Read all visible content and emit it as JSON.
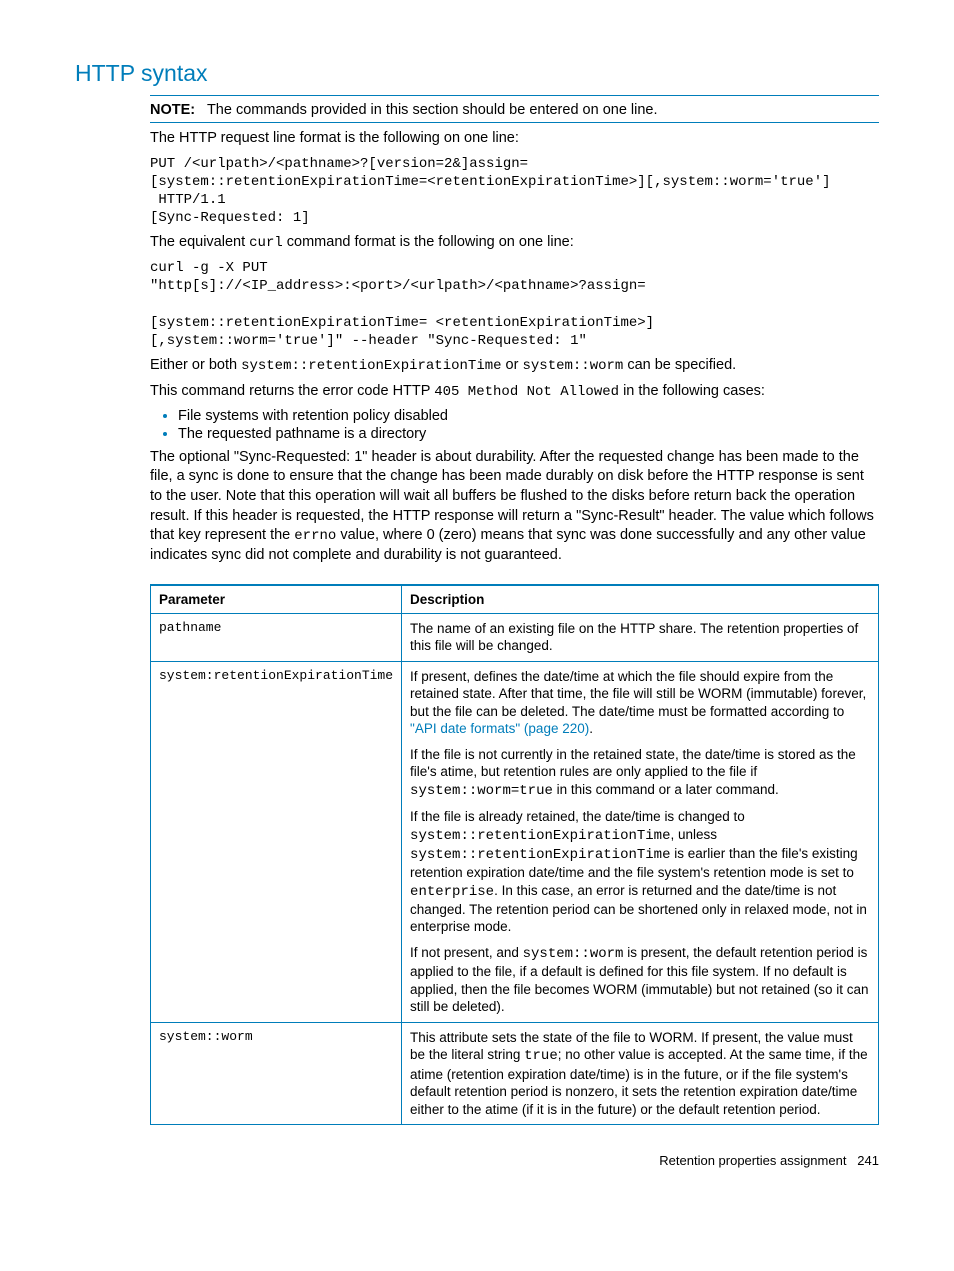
{
  "heading": "HTTP syntax",
  "note": {
    "label": "NOTE:",
    "text": "The commands provided in this section should be entered on one line."
  },
  "intro1": "The HTTP request line format is the following on one line:",
  "code1": "PUT /<urlpath>/<pathname>?[version=2&]assign=\n[system::retentionExpirationTime=<retentionExpirationTime>][,system::worm='true']\n HTTP/1.1\n[Sync-Requested: 1]",
  "intro2_pre": "The equivalent ",
  "intro2_code": "curl",
  "intro2_post": " command format is the following on one line:",
  "code2": "curl -g -X PUT \n\"http[s]://<IP_address>:<port>/<urlpath>/<pathname>?assign=\n\n[system::retentionExpirationTime= <retentionExpirationTime>]\n[,system::worm='true']\" --header \"Sync-Requested: 1\"",
  "either_pre": "Either or both ",
  "either_c1": "system::retentionExpirationTime",
  "either_mid": " or ",
  "either_c2": "system::worm",
  "either_post": " can be specified.",
  "err_pre": "This command returns the error code HTTP ",
  "err_code": "405 Method Not Allowed",
  "err_post": " in the following cases:",
  "bullets": [
    "File systems with retention policy disabled",
    "The requested pathname is a directory"
  ],
  "sync_p1": "The optional \"Sync-Requested: 1\" header is about durability. After the requested change has been made to the file, a sync is done to ensure that the change has been made durably on disk before the HTTP response is sent to the user. Note that this operation will wait all buffers be flushed to the disks before return back the operation result. If this header is requested, the HTTP response will return a \"Sync-Result\" header. The value which follows that key represent the ",
  "sync_code": "errno",
  "sync_p2": " value, where 0 (zero) means that sync was done successfully and any other value indicates sync did not complete and durability is not guaranteed.",
  "table": {
    "headers": [
      "Parameter",
      "Description"
    ],
    "rows": [
      {
        "param": "pathname",
        "desc": [
          {
            "type": "plain",
            "text": "The name of an existing file on the HTTP share. The retention properties of this file will be changed."
          }
        ]
      },
      {
        "param": "system:retentionExpirationTime",
        "desc": [
          {
            "type": "mixed",
            "parts": [
              {
                "t": "text",
                "v": "If present, defines the date/time at which the file should expire from the retained state. After that time, the file will still be WORM (immutable) forever, but the file can be deleted. The date/time must be formatted according to "
              },
              {
                "t": "link",
                "v": "\"API date formats\" (page 220)"
              },
              {
                "t": "text",
                "v": "."
              }
            ]
          },
          {
            "type": "mixed",
            "parts": [
              {
                "t": "text",
                "v": "If the file is not currently in the retained state, the date/time is stored as the file's atime, but retention rules are only applied to the file if "
              },
              {
                "t": "code",
                "v": "system::worm=true"
              },
              {
                "t": "text",
                "v": " in this command or a later command."
              }
            ]
          },
          {
            "type": "mixed",
            "parts": [
              {
                "t": "text",
                "v": "If the file is already retained, the date/time is changed to "
              },
              {
                "t": "code",
                "v": "system::retentionExpirationTime"
              },
              {
                "t": "text",
                "v": ", unless "
              },
              {
                "t": "code",
                "v": "system::retentionExpirationTime"
              },
              {
                "t": "text",
                "v": " is earlier than the file's existing retention expiration date/time and the file system's retention mode is set to "
              },
              {
                "t": "code",
                "v": "enterprise"
              },
              {
                "t": "text",
                "v": ". In this case, an error is returned and the date/time is not changed. The retention period can be shortened only in relaxed mode, not in enterprise mode."
              }
            ]
          },
          {
            "type": "mixed",
            "parts": [
              {
                "t": "text",
                "v": "If not present, and "
              },
              {
                "t": "code",
                "v": "system::worm"
              },
              {
                "t": "text",
                "v": " is present, the default retention period is applied to the file, if a default is defined for this file system. If no default is applied, then the file becomes WORM (immutable) but not retained (so it can still be deleted)."
              }
            ]
          }
        ]
      },
      {
        "param": "system::worm",
        "desc": [
          {
            "type": "mixed",
            "parts": [
              {
                "t": "text",
                "v": "This attribute sets the state of the file to WORM. If present, the value must be the literal string "
              },
              {
                "t": "code",
                "v": "true"
              },
              {
                "t": "text",
                "v": "; no other value is accepted. At the same time, if the atime (retention expiration date/time) is in the future, or if the file system's default retention period is nonzero, it sets the retention expiration date/time either to the atime (if it is in the future) or the default retention period."
              }
            ]
          }
        ]
      }
    ]
  },
  "footer": {
    "title": "Retention properties assignment",
    "page": "241"
  }
}
